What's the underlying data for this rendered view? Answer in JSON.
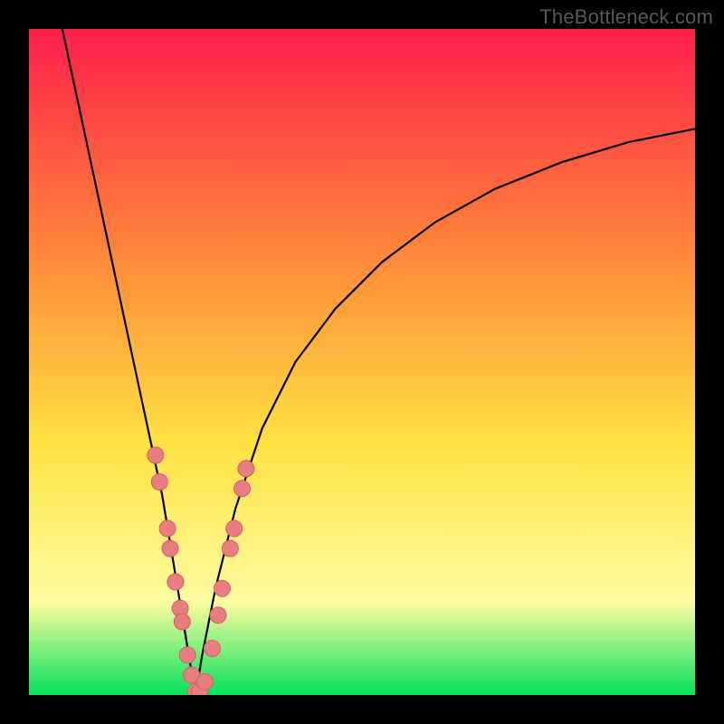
{
  "watermark": "TheBottleneck.com",
  "colors": {
    "frame": "#000000",
    "gradient_top": "#ff1f4b",
    "gradient_mid1": "#ff823a",
    "gradient_mid2": "#ffe141",
    "gradient_mid3": "#fdfca0",
    "gradient_bottom": "#04e25c",
    "curve": "#000000",
    "marker_fill": "#e97e82",
    "marker_stroke": "#d85e63"
  },
  "chart_data": {
    "type": "line",
    "title": "",
    "xlabel": "",
    "ylabel": "",
    "xlim": [
      0,
      100
    ],
    "ylim": [
      0,
      100
    ],
    "grid": false,
    "legend": false,
    "series": [
      {
        "name": "bottleneck-curve",
        "comment": "V-shaped curve; y is bottleneck %, minimum near x≈25",
        "x": [
          5,
          8,
          11,
          14,
          17,
          20,
          22,
          24,
          25,
          26,
          28,
          31,
          35,
          40,
          46,
          53,
          61,
          70,
          80,
          90,
          100
        ],
        "y": [
          100,
          86,
          72,
          58,
          44,
          30,
          18,
          6,
          0,
          6,
          16,
          28,
          40,
          50,
          58,
          65,
          71,
          76,
          80,
          83,
          85
        ]
      }
    ],
    "markers": {
      "comment": "Pink sample dots overlaid on the curve near the trough",
      "points": [
        {
          "x": 19.0,
          "y": 36
        },
        {
          "x": 19.6,
          "y": 32
        },
        {
          "x": 20.8,
          "y": 25
        },
        {
          "x": 21.2,
          "y": 22
        },
        {
          "x": 22.0,
          "y": 17
        },
        {
          "x": 22.7,
          "y": 13
        },
        {
          "x": 23.0,
          "y": 11
        },
        {
          "x": 23.8,
          "y": 6
        },
        {
          "x": 24.4,
          "y": 3
        },
        {
          "x": 25.0,
          "y": 0.5
        },
        {
          "x": 25.6,
          "y": 0.5
        },
        {
          "x": 26.4,
          "y": 2
        },
        {
          "x": 27.5,
          "y": 7
        },
        {
          "x": 28.4,
          "y": 12
        },
        {
          "x": 29.0,
          "y": 16
        },
        {
          "x": 30.2,
          "y": 22
        },
        {
          "x": 30.8,
          "y": 25
        },
        {
          "x": 32.0,
          "y": 31
        },
        {
          "x": 32.6,
          "y": 34
        }
      ]
    },
    "background_gradient": {
      "direction": "vertical",
      "stops": [
        {
          "pos": 0.0,
          "meaning": "high-bottleneck",
          "color": "#ff1f4b"
        },
        {
          "pos": 0.32,
          "meaning": "",
          "color": "#ff823a"
        },
        {
          "pos": 0.62,
          "meaning": "",
          "color": "#ffe141"
        },
        {
          "pos": 0.86,
          "meaning": "",
          "color": "#fdfca0"
        },
        {
          "pos": 1.0,
          "meaning": "no-bottleneck",
          "color": "#04e25c"
        }
      ]
    }
  }
}
